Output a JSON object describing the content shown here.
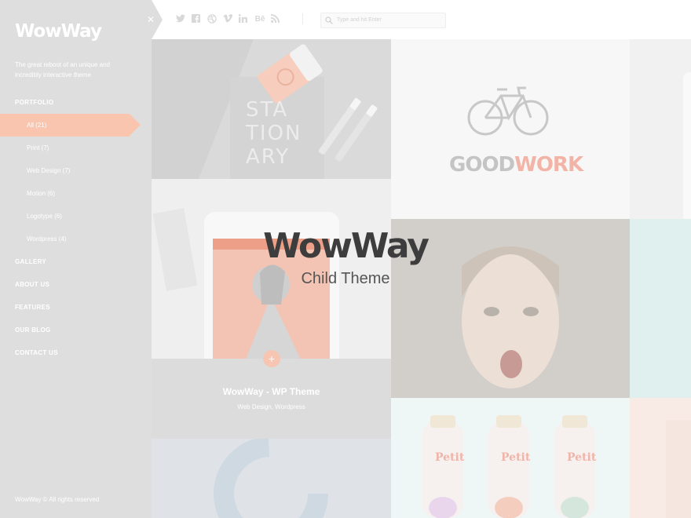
{
  "sidebar": {
    "logo": "WowWay",
    "tagline": "The great reboot of an unique and incredibly interactive theme",
    "nav": {
      "portfolio": "PORTFOLIO",
      "sub": [
        {
          "label": "All (21)",
          "active": true
        },
        {
          "label": "Print (7)"
        },
        {
          "label": "Web Design (7)"
        },
        {
          "label": "Motion (6)"
        },
        {
          "label": "Logotype (6)"
        },
        {
          "label": "Wordpress (4)"
        }
      ],
      "gallery": "GALLERY",
      "about": "ABOUT US",
      "features": "FEATURES",
      "blog": "OUR BLOG",
      "contact": "CONTACT US"
    },
    "copyright": "WowWay © All rights reserved"
  },
  "topbar": {
    "social_icons": [
      "twitter-icon",
      "facebook-icon",
      "dribbble-icon",
      "vimeo-icon",
      "linkedin-icon",
      "behance-icon",
      "rss-icon"
    ],
    "search_placeholder": "Type and hit Enter"
  },
  "tiles": {
    "stationery_text": "STATIONARY",
    "goodwork_1": "GOOD",
    "goodwork_2": "WORK",
    "caption_title": "WowWay - WP Theme",
    "caption_sub": "Web Design, Wordpress",
    "plus_label": "+"
  },
  "overlay": {
    "title": "WowWay",
    "subtitle": "Child Theme"
  },
  "colors": {
    "accent": "#f9c5af",
    "sidebar_bg": "#dedede",
    "overlay_text": "#3d3d3d"
  }
}
